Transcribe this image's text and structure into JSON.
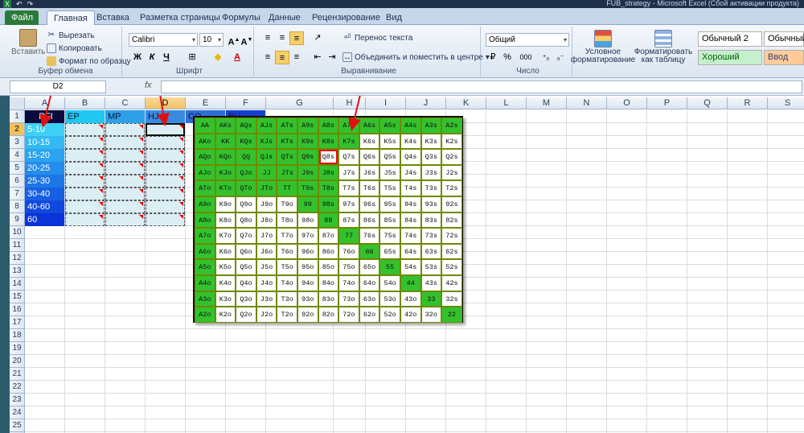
{
  "titlebar": {
    "title": "FUB_strategy  -  Microsoft Excel (Сбой активации продукта)",
    "quick": [
      "X",
      "↶",
      "↷"
    ]
  },
  "tabs": [
    "Файл",
    "Главная",
    "Вставка",
    "Разметка страницы",
    "Формулы",
    "Данные",
    "Рецензирование",
    "Вид"
  ],
  "ribbon": {
    "clipboard": {
      "paste": "Вставить",
      "cut": "Вырезать",
      "copy": "Копировать",
      "format_painter": "Формат по образцу",
      "label": "Буфер обмена"
    },
    "font": {
      "name": "Calibri",
      "size": "10",
      "bold": "Ж",
      "italic": "К",
      "underline": "Ч",
      "label": "Шрифт"
    },
    "alignment": {
      "wrap": "Перенос текста",
      "merge": "Объединить и поместить в центре",
      "label": "Выравнивание"
    },
    "number": {
      "format": "Общий",
      "percent": "%",
      "thousands": "000",
      "label": "Число"
    },
    "styles": {
      "cond": "Условное форматирование",
      "table": "Форматировать как таблицу",
      "s1": "Обычный 2",
      "s2": "Обычный",
      "good": "Хороший",
      "neutral": "Ввод"
    }
  },
  "formula_bar": {
    "namebox": "D2",
    "fx": "fx"
  },
  "columns": [
    "A",
    "B",
    "C",
    "D",
    "E",
    "F",
    "G",
    "H",
    "I",
    "J",
    "K",
    "L",
    "M",
    "N",
    "O",
    "P",
    "Q",
    "R",
    "S"
  ],
  "rows": [
    "1",
    "2",
    "3",
    "4",
    "5",
    "6",
    "7",
    "8",
    "9",
    "10",
    "11",
    "12",
    "13",
    "14",
    "15",
    "16",
    "17",
    "18",
    "19",
    "20",
    "21",
    "22",
    "23",
    "24",
    "25",
    "26"
  ],
  "headers_row1": [
    "RFI",
    "EP",
    "MP",
    "HJ",
    "CO",
    "BU"
  ],
  "colA": [
    "5-10",
    "10-15",
    "15-20",
    "20-25",
    "25-30",
    "30-40",
    "40-60",
    "60"
  ],
  "poker_grid": [
    [
      "AA",
      "AKs",
      "AQs",
      "AJs",
      "ATs",
      "A9s",
      "A8s",
      "A7s",
      "A6s",
      "A5s",
      "A4s",
      "A3s",
      "A2s"
    ],
    [
      "AKo",
      "KK",
      "KQs",
      "KJs",
      "KTs",
      "K9s",
      "K8s",
      "K7s",
      "K6s",
      "K5s",
      "K4s",
      "K3s",
      "K2s"
    ],
    [
      "AQo",
      "KQo",
      "QQ",
      "QJs",
      "QTs",
      "Q9s",
      "Q8s",
      "Q7s",
      "Q6s",
      "Q5s",
      "Q4s",
      "Q3s",
      "Q2s"
    ],
    [
      "AJo",
      "KJo",
      "QJo",
      "JJ",
      "JTs",
      "J9s",
      "J8s",
      "J7s",
      "J6s",
      "J5s",
      "J4s",
      "J3s",
      "J2s"
    ],
    [
      "ATo",
      "KTo",
      "QTo",
      "JTo",
      "TT",
      "T9s",
      "T8s",
      "T7s",
      "T6s",
      "T5s",
      "T4s",
      "T3s",
      "T2s"
    ],
    [
      "A9o",
      "K9o",
      "Q9o",
      "J9o",
      "T9o",
      "99",
      "98s",
      "97s",
      "96s",
      "95s",
      "94s",
      "93s",
      "92s"
    ],
    [
      "A8o",
      "K8o",
      "Q8o",
      "J8o",
      "T8o",
      "98o",
      "88",
      "87s",
      "86s",
      "85s",
      "84s",
      "83s",
      "82s"
    ],
    [
      "A7o",
      "K7o",
      "Q7o",
      "J7o",
      "T7o",
      "97o",
      "87o",
      "77",
      "76s",
      "75s",
      "74s",
      "73s",
      "72s"
    ],
    [
      "A6o",
      "K6o",
      "Q6o",
      "J6o",
      "T6o",
      "96o",
      "86o",
      "76o",
      "66",
      "65s",
      "64s",
      "63s",
      "62s"
    ],
    [
      "A5o",
      "K5o",
      "Q5o",
      "J5o",
      "T5o",
      "95o",
      "85o",
      "75o",
      "65o",
      "55",
      "54s",
      "53s",
      "52s"
    ],
    [
      "A4o",
      "K4o",
      "Q4o",
      "J4o",
      "T4o",
      "94o",
      "84o",
      "74o",
      "64o",
      "54o",
      "44",
      "43s",
      "42s"
    ],
    [
      "A3o",
      "K3o",
      "Q3o",
      "J3o",
      "T3o",
      "93o",
      "83o",
      "73o",
      "63o",
      "53o",
      "43o",
      "33",
      "32s"
    ],
    [
      "A2o",
      "K2o",
      "Q2o",
      "J2o",
      "T2o",
      "92o",
      "82o",
      "72o",
      "62o",
      "52o",
      "42o",
      "32o",
      "22"
    ]
  ],
  "colors": {
    "green": "#33c22d",
    "selected_outline": "#e01010"
  }
}
